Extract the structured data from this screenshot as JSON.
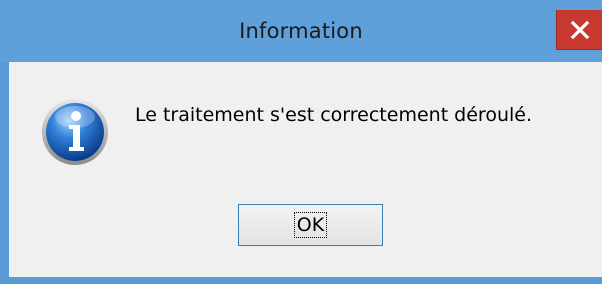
{
  "window": {
    "title": "Information",
    "titlebar_color": "#60a0da",
    "close_button_color": "#c7392f",
    "close_icon": "close-icon"
  },
  "dialog": {
    "icon": "info-icon",
    "message": "Le traitement s'est correctement déroulé.",
    "ok_label": "OK"
  }
}
